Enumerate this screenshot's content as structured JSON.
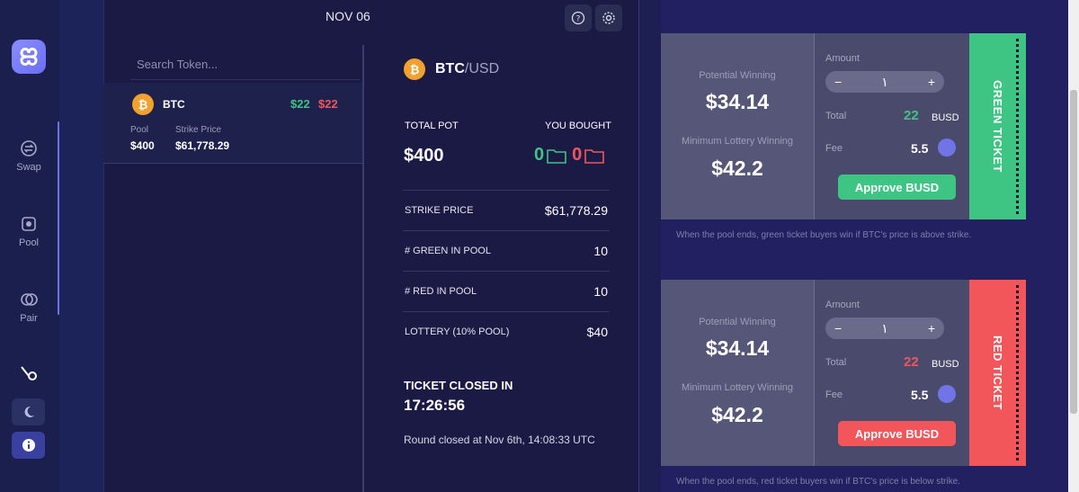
{
  "sidebar": {
    "items": [
      {
        "label": "Swap",
        "icon": "swap-icon"
      },
      {
        "label": "Pool",
        "icon": "pool-icon"
      },
      {
        "label": "Pair",
        "icon": "pair-icon"
      },
      {
        "label": "",
        "icon": "bike-icon"
      }
    ]
  },
  "header": {
    "date": "NOV 06"
  },
  "search": {
    "placeholder": "Search Token..."
  },
  "token_list": [
    {
      "symbol": "BTC",
      "green": "$22",
      "red": "$22",
      "pool_label": "Pool",
      "pool": "$400",
      "strike_label": "Strike Price",
      "strike": "$61,778.29"
    }
  ],
  "detail": {
    "pair_base": "BTC",
    "pair_quote": "/USD",
    "total_pot_label": "TOTAL POT",
    "total_pot": "$400",
    "bought_label": "YOU BOUGHT",
    "bought_green": "0",
    "bought_red": "0",
    "stats": [
      {
        "label": "STRIKE PRICE",
        "value": "$61,778.29"
      },
      {
        "label": "# GREEN IN POOL",
        "value": "10"
      },
      {
        "label": "# RED IN POOL",
        "value": "10"
      },
      {
        "label": "LOTTERY (10% POOL)",
        "value": "$40"
      }
    ],
    "closed_label": "TICKET CLOSED IN",
    "closed_time": "17:26:56",
    "round_text": "Round closed at Nov 6th, 14:08:33 UTC"
  },
  "green_ticket": {
    "potential_label": "Potential Winning",
    "potential": "$34.14",
    "minimum_label": "Minimum Lottery Winning",
    "minimum": "$42.2",
    "amount_label": "Amount",
    "amount": "١",
    "total_label": "Total",
    "total": "22",
    "currency": "BUSD",
    "fee_label": "Fee",
    "fee": "5.5",
    "approve": "Approve BUSD",
    "stub": "GREEN TICKET",
    "note": "When the pool ends, green ticket buyers win if BTC's price is above strike.",
    "color": "#3ec483"
  },
  "red_ticket": {
    "potential_label": "Potential Winning",
    "potential": "$34.14",
    "minimum_label": "Minimum Lottery Winning",
    "minimum": "$42.2",
    "amount_label": "Amount",
    "amount": "١",
    "total_label": "Total",
    "total": "22",
    "currency": "BUSD",
    "fee_label": "Fee",
    "fee": "5.5",
    "approve": "Approve BUSD",
    "stub": "RED TICKET",
    "note": "When the pool ends, red ticket buyers win if BTC's price is below strike.",
    "color": "#f2565b"
  }
}
